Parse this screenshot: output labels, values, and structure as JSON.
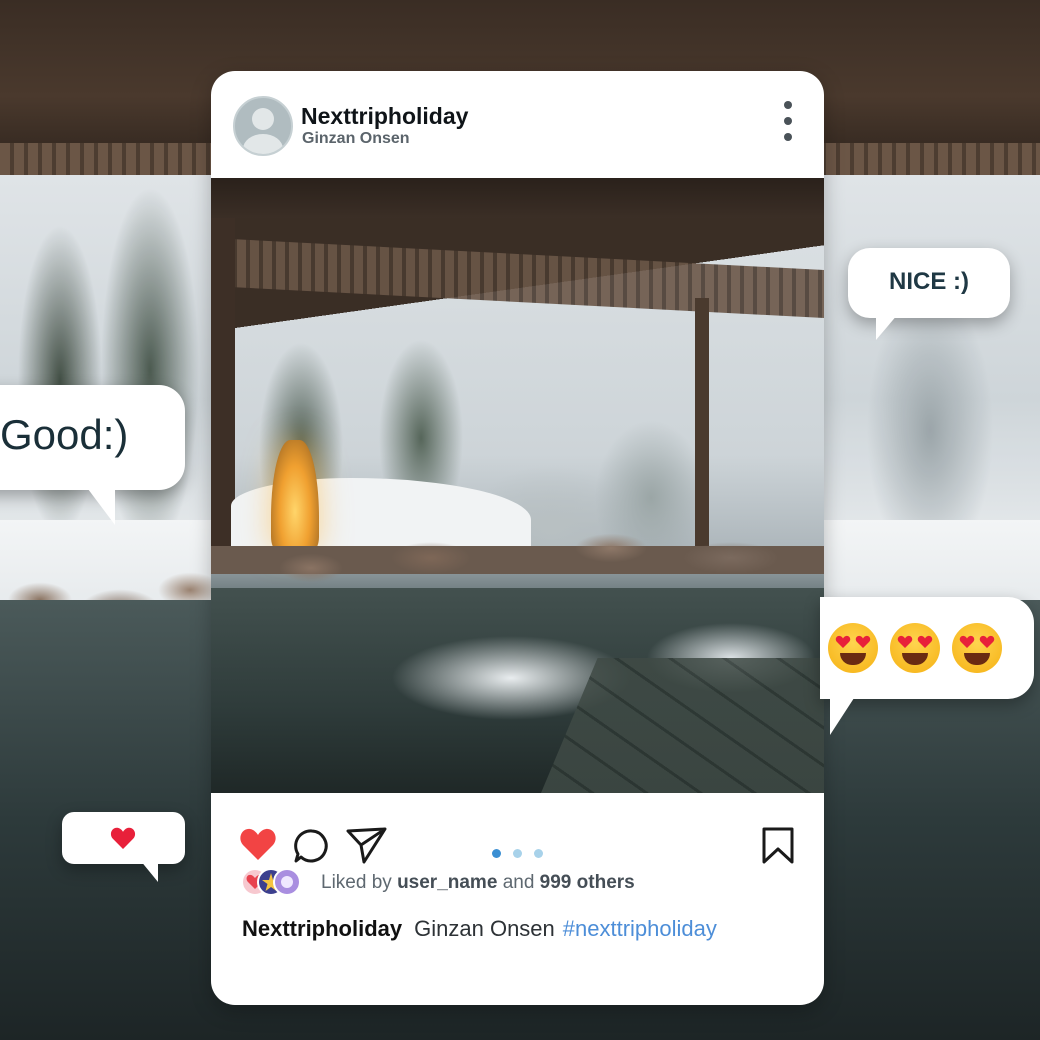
{
  "post": {
    "username": "Nexttripholiday",
    "location": "Ginzan Onsen",
    "likes": {
      "prefix": "Liked by",
      "user": "user_name",
      "joiner": "and",
      "others": "999 others"
    },
    "caption": {
      "username": "Nexttripholiday",
      "text": "Ginzan Onsen",
      "hashtag": "#nexttripholiday"
    },
    "carousel": {
      "count": 3,
      "active_index": 0
    },
    "colors": {
      "like": "#f24444",
      "hashtag": "#4d8ed8",
      "carousel_active": "#3b8fd3",
      "carousel_inactive": "#a8d2ea"
    },
    "icons": [
      "heart-icon",
      "comment-icon",
      "share-icon",
      "bookmark-icon",
      "more-options-icon"
    ]
  },
  "bubbles": {
    "good": "Good:)",
    "nice": "NICE :)",
    "emoji_count": 3
  }
}
